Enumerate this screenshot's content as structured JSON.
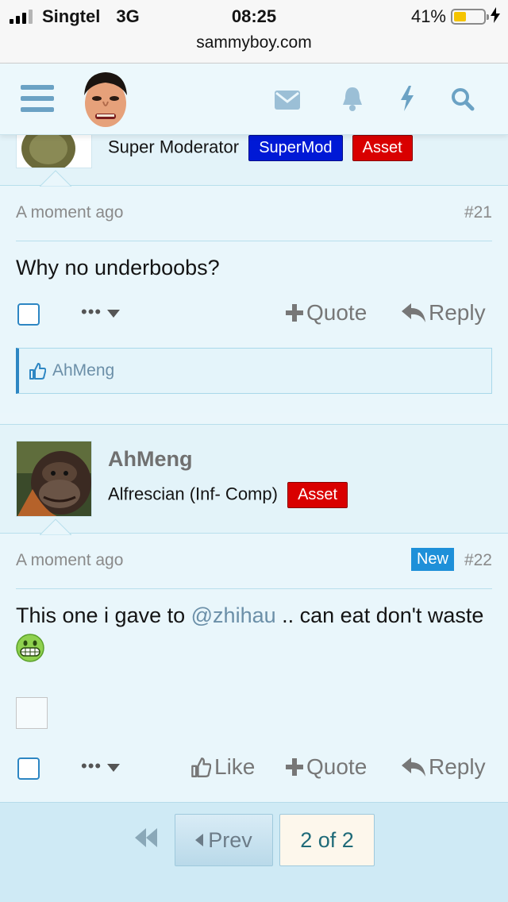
{
  "status": {
    "carrier": "Singtel",
    "network": "3G",
    "time": "08:25",
    "battery_percent": "41%",
    "battery_level": 0.41,
    "url": "sammyboy.com"
  },
  "header": {
    "menu_icon": "hamburger-menu-icon",
    "logo": "site-mascot-logo",
    "icons": [
      "envelope-icon",
      "bell-icon",
      "lightning-icon",
      "search-icon"
    ]
  },
  "post21": {
    "user_title": "Super Moderator",
    "badges": [
      "SuperMod",
      "Asset"
    ],
    "time": "A moment ago",
    "number": "#21",
    "message": "Why no underboobs?",
    "more": "•••",
    "quote": "Quote",
    "reply": "Reply",
    "liked_by": "AhMeng"
  },
  "post22": {
    "username": "AhMeng",
    "user_title": "Alfrescian (Inf- Comp)",
    "badge": "Asset",
    "time": "A moment ago",
    "new_label": "New",
    "number": "#22",
    "message_before": "This one i gave to ",
    "mention": "@zhihau",
    "message_after": " .. can eat don't waste",
    "more": "•••",
    "like": "Like",
    "quote": "Quote",
    "reply": "Reply"
  },
  "pagination": {
    "prev": "Prev",
    "current": "2 of 2"
  },
  "colors": {
    "supermod_badge": "#0019d6",
    "asset_badge": "#d90000",
    "new_badge": "#1e90d9",
    "accent": "#2d86c3"
  }
}
